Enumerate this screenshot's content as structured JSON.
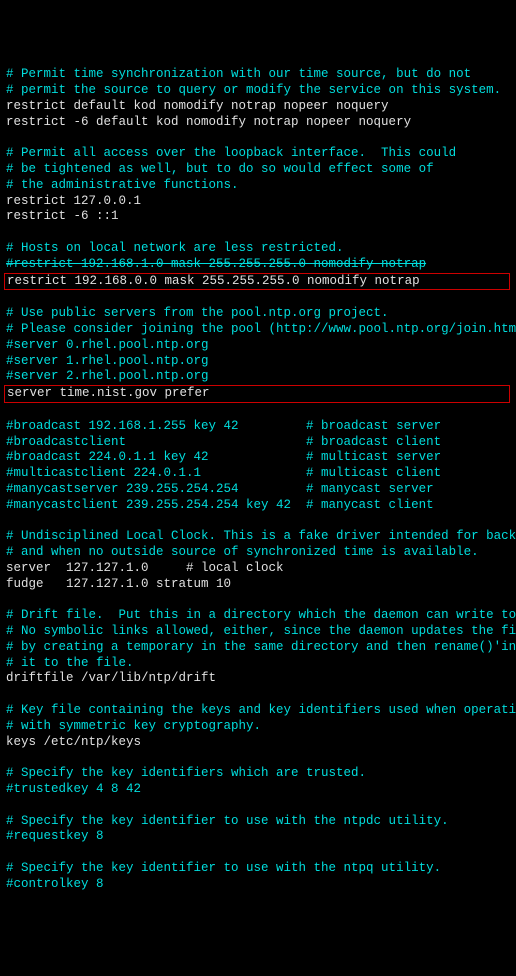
{
  "lines": [
    {
      "cls": "comment",
      "txt": "# Permit time synchronization with our time source, but do not"
    },
    {
      "cls": "comment",
      "txt": "# permit the source to query or modify the service on this system."
    },
    {
      "cls": "code",
      "txt": "restrict default kod nomodify notrap nopeer noquery"
    },
    {
      "cls": "code",
      "txt": "restrict -6 default kod nomodify notrap nopeer noquery"
    },
    {
      "cls": "blank",
      "txt": " "
    },
    {
      "cls": "comment",
      "txt": "# Permit all access over the loopback interface.  This could"
    },
    {
      "cls": "comment",
      "txt": "# be tightened as well, but to do so would effect some of"
    },
    {
      "cls": "comment",
      "txt": "# the administrative functions."
    },
    {
      "cls": "code",
      "txt": "restrict 127.0.0.1"
    },
    {
      "cls": "code",
      "txt": "restrict -6 ::1"
    },
    {
      "cls": "blank",
      "txt": " "
    },
    {
      "cls": "comment",
      "txt": "# Hosts on local network are less restricted."
    },
    {
      "cls": "comment strike",
      "txt": "#restrict 192.168.1.0 mask 255.255.255.0 nomodify notrap"
    },
    {
      "cls": "code boxed",
      "txt": "restrict 192.168.0.0 mask 255.255.255.0 nomodify notrap"
    },
    {
      "cls": "blank",
      "txt": " "
    },
    {
      "cls": "comment",
      "txt": "# Use public servers from the pool.ntp.org project."
    },
    {
      "cls": "comment",
      "txt": "# Please consider joining the pool (http://www.pool.ntp.org/join.html)."
    },
    {
      "cls": "comment",
      "txt": "#server 0.rhel.pool.ntp.org"
    },
    {
      "cls": "comment",
      "txt": "#server 1.rhel.pool.ntp.org"
    },
    {
      "cls": "comment",
      "txt": "#server 2.rhel.pool.ntp.org"
    },
    {
      "cls": "code boxed",
      "txt": "server time.nist.gov prefer"
    },
    {
      "cls": "blank",
      "txt": " "
    },
    {
      "cls": "comment",
      "txt": "#broadcast 192.168.1.255 key 42         # broadcast server"
    },
    {
      "cls": "comment",
      "txt": "#broadcastclient                        # broadcast client"
    },
    {
      "cls": "comment",
      "txt": "#broadcast 224.0.1.1 key 42             # multicast server"
    },
    {
      "cls": "comment",
      "txt": "#multicastclient 224.0.1.1              # multicast client"
    },
    {
      "cls": "comment",
      "txt": "#manycastserver 239.255.254.254         # manycast server"
    },
    {
      "cls": "comment",
      "txt": "#manycastclient 239.255.254.254 key 42  # manycast client"
    },
    {
      "cls": "blank",
      "txt": " "
    },
    {
      "cls": "comment",
      "txt": "# Undisciplined Local Clock. This is a fake driver intended for backup"
    },
    {
      "cls": "comment",
      "txt": "# and when no outside source of synchronized time is available."
    },
    {
      "cls": "code",
      "txt": "server  127.127.1.0     # local clock"
    },
    {
      "cls": "code",
      "txt": "fudge   127.127.1.0 stratum 10"
    },
    {
      "cls": "blank",
      "txt": " "
    },
    {
      "cls": "comment",
      "txt": "# Drift file.  Put this in a directory which the daemon can write to."
    },
    {
      "cls": "comment",
      "txt": "# No symbolic links allowed, either, since the daemon updates the file"
    },
    {
      "cls": "comment",
      "txt": "# by creating a temporary in the same directory and then rename()'ing"
    },
    {
      "cls": "comment",
      "txt": "# it to the file."
    },
    {
      "cls": "code",
      "txt": "driftfile /var/lib/ntp/drift"
    },
    {
      "cls": "blank",
      "txt": " "
    },
    {
      "cls": "comment",
      "txt": "# Key file containing the keys and key identifiers used when operating"
    },
    {
      "cls": "comment",
      "txt": "# with symmetric key cryptography."
    },
    {
      "cls": "code",
      "txt": "keys /etc/ntp/keys"
    },
    {
      "cls": "blank",
      "txt": " "
    },
    {
      "cls": "comment",
      "txt": "# Specify the key identifiers which are trusted."
    },
    {
      "cls": "comment",
      "txt": "#trustedkey 4 8 42"
    },
    {
      "cls": "blank",
      "txt": " "
    },
    {
      "cls": "comment",
      "txt": "# Specify the key identifier to use with the ntpdc utility."
    },
    {
      "cls": "comment",
      "txt": "#requestkey 8"
    },
    {
      "cls": "blank",
      "txt": " "
    },
    {
      "cls": "comment",
      "txt": "# Specify the key identifier to use with the ntpq utility."
    },
    {
      "cls": "comment",
      "txt": "#controlkey 8"
    }
  ]
}
